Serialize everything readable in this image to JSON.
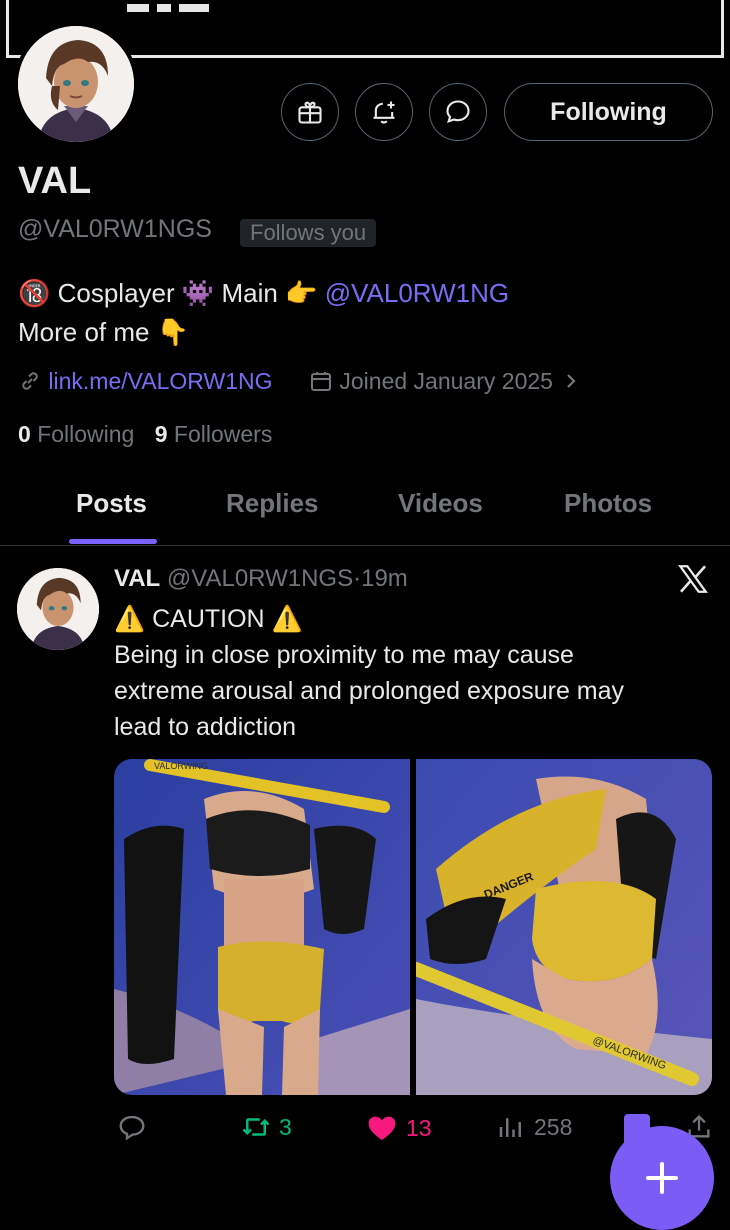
{
  "profile": {
    "name": "VAL",
    "handle": "@VAL0RW1NGS",
    "follows_you": "Follows you",
    "follow_button": "Following",
    "bio_line1_text": "Cosplayer",
    "bio_main": "Main",
    "bio_mention": "@VAL0RW1NG",
    "bio_line2": "More of me",
    "link": "link.me/VALORW1NG",
    "joined": "Joined January 2025",
    "following_count": "0",
    "following_label": "Following",
    "followers_count": "9",
    "followers_label": "Followers"
  },
  "tabs": [
    "Posts",
    "Replies",
    "Videos",
    "Photos"
  ],
  "active_tab": "Posts",
  "post": {
    "author": "VAL",
    "handle": "@VAL0RW1NGS",
    "time": "19m",
    "line1": "CAUTION",
    "line2": "Being in close proximity to me may cause",
    "line3": "extreme arousal and prolonged exposure may",
    "line4": "lead to addiction",
    "image1_label": "VALORWING",
    "image2_label": "@VALORWING",
    "image2_sleeve": "DANGER",
    "replies": "",
    "reposts": "3",
    "likes": "13",
    "views": "258"
  },
  "colors": {
    "accent": "#7b61ff",
    "link": "#7b6cf6",
    "repost": "#00ba7c",
    "like": "#f91880",
    "muted": "#71767b"
  },
  "icons": [
    "gift-icon",
    "bell-plus-icon",
    "message-icon",
    "link-icon",
    "calendar-icon",
    "chevron-right-icon",
    "x-logo-icon",
    "reply-icon",
    "repost-icon",
    "heart-icon",
    "views-icon",
    "share-icon",
    "plus-icon"
  ]
}
